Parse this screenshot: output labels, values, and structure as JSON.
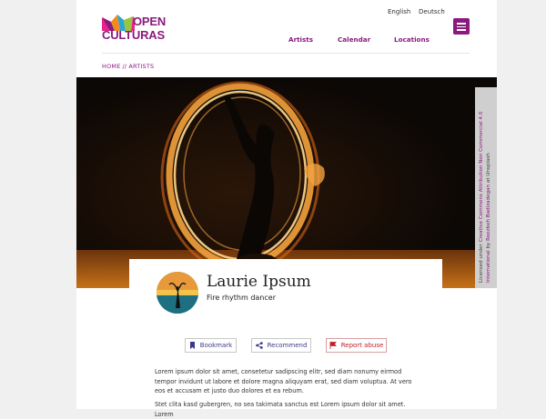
{
  "header": {
    "logo": {
      "line1": "OPEN",
      "line2": "CULTURAS"
    },
    "languages": [
      "English",
      "Deutsch"
    ],
    "nav": [
      "Artists",
      "Calendar",
      "Locations"
    ],
    "menu_icon": "hamburger-icon"
  },
  "breadcrumb": {
    "home": "HOME",
    "separator": "//",
    "current": "ARTISTS"
  },
  "hero": {
    "credit_prefix": "Licensed under ",
    "license": "Creative Commons Attribution Non Commercial 4.0 International",
    "by": " by ",
    "author": "Roozbeh Badizadegan",
    "suffix": " at Unsplash"
  },
  "profile": {
    "name": "Laurie Ipsum",
    "role": "Fire rhythm dancer"
  },
  "actions": {
    "bookmark": "Bookmark",
    "recommend": "Recommend",
    "report": "Report abuse"
  },
  "content": {
    "paragraph1": "Lorem ipsum dolor sit amet, consetetur sadipscing elitr, sed diam nonumy eirmod tempor invidunt ut labore et dolore magna aliquyam erat, sed diam voluptua. At vero eos et accusam et justo duo dolores et ea rebum.",
    "paragraph2": "Stet clita kasd gubergren, no sea takimata sanctus est Lorem ipsum dolor sit amet. Lorem"
  },
  "colors": {
    "brand": "#8a1a7d",
    "report": "#c0202c",
    "link": "#3a3a8a"
  }
}
